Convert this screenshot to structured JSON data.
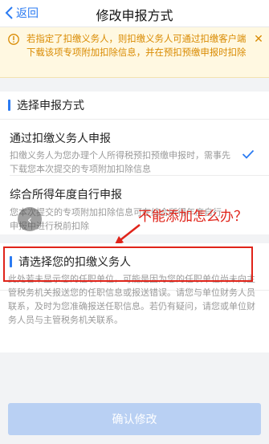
{
  "header": {
    "back_label": "返回",
    "title": "修改申报方式"
  },
  "notice": {
    "text": "若指定了扣缴义务人，则扣缴义务人可通过扣缴客户端下载该项专项附加扣除信息，并在预扣预缴申报时扣除",
    "color": "#d98a00",
    "background": "#fff8e1",
    "icon": "warning-icon"
  },
  "method_section": {
    "heading": "选择申报方式",
    "options": [
      {
        "title": "通过扣缴义务人申报",
        "desc": "扣缴义务人为您办理个人所得税预扣预缴申报时，需事先下载您本次提交的专项附加扣除信息",
        "selected": true
      },
      {
        "title": "综合所得年度自行申报",
        "desc": "您本次提交的专项附加扣除信息可在综合所得年度自行申报中进行税前扣除",
        "selected": false
      }
    ]
  },
  "annotation": {
    "text": "不能添加怎么办？",
    "color": "#e0241a"
  },
  "agent_section": {
    "heading": "请选择您的扣缴义务人",
    "info": "此处若未显示您的任职单位，可能是因为您的任职单位尚未向主管税务机关报送您的任职信息或报送错误。请您与单位财务人员联系，及时为您准确报送任职信息。若仍有疑问，请您或单位财务人员与主管税务机关联系。"
  },
  "footer": {
    "confirm_label": "确认修改",
    "enabled": false
  },
  "accent_color": "#2b7bf2"
}
